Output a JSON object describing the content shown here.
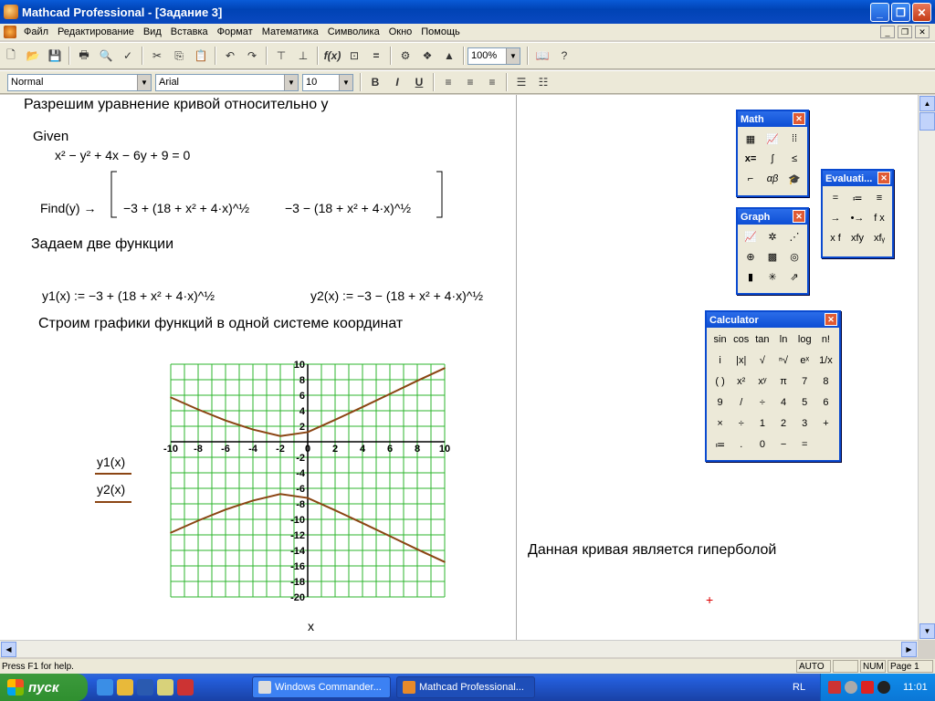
{
  "window": {
    "title": "Mathcad Professional - [Задание 3]"
  },
  "menu": [
    "Файл",
    "Редактирование",
    "Вид",
    "Вставка",
    "Формат",
    "Математика",
    "Символика",
    "Окно",
    "Помощь"
  ],
  "toolbar": {
    "zoom": "100%"
  },
  "format_bar": {
    "style": "Normal",
    "font": "Arial",
    "size": "10",
    "bold": "B",
    "italic": "I",
    "underline": "U"
  },
  "doc": {
    "heading1": "Разрешим уравнение кривой относительно y",
    "given": "Given",
    "equation": "x² − y² + 4x − 6y + 9 = 0",
    "find_label": "Find(y) →",
    "find_r1": "−3 + (18 + x² + 4·x)^½",
    "find_r2": "−3 − (18 + x² + 4·x)^½",
    "heading2": "Задаем две функции",
    "y1_def": "y1(x) := −3 + (18 + x² + 4·x)^½",
    "y2_def": "y2(x) := −3 − (18 + x² + 4·x)^½",
    "heading3": "Строим графики функций в одной системе координат",
    "legend_y1": "y1(x)",
    "legend_y2": "y2(x)",
    "xlabel": "x",
    "conclusion": "Данная кривая является гиперболой",
    "cursor": "+"
  },
  "chart_data": {
    "type": "line",
    "xlim": [
      -10,
      10
    ],
    "ylim": [
      -20,
      10
    ],
    "xticks": [
      -10,
      -8,
      -6,
      -4,
      -2,
      0,
      2,
      4,
      6,
      8,
      10
    ],
    "yticks": [
      10,
      8,
      6,
      4,
      2,
      -2,
      -4,
      -6,
      -8,
      -10,
      -12,
      -14,
      -16,
      -18,
      -20
    ],
    "grid": true,
    "series": [
      {
        "name": "y1(x)",
        "color": "#8b4513",
        "x": [
          -10,
          -8,
          -6,
          -4,
          -2,
          0,
          2,
          4,
          6,
          8,
          10
        ],
        "y": [
          5.72,
          4.16,
          2.74,
          1.58,
          0.74,
          1.24,
          2.83,
          4.48,
          6.16,
          7.86,
          9.49
        ]
      },
      {
        "name": "y2(x)",
        "color": "#8b4513",
        "x": [
          -10,
          -8,
          -6,
          -4,
          -2,
          0,
          2,
          4,
          6,
          8,
          10
        ],
        "y": [
          -11.72,
          -10.16,
          -8.74,
          -7.58,
          -6.74,
          -7.24,
          -8.83,
          -10.48,
          -12.16,
          -13.86,
          -15.49
        ]
      }
    ]
  },
  "palettes": {
    "math": {
      "title": "Math"
    },
    "evaluation": {
      "title": "Evaluati...",
      "cells": [
        "=",
        "≔",
        "≡",
        "→",
        "•→",
        "f x",
        "x f",
        "xfy",
        "xfᵧ"
      ]
    },
    "graph": {
      "title": "Graph"
    },
    "calculator": {
      "title": "Calculator",
      "cells": [
        "sin",
        "cos",
        "tan",
        "ln",
        "log",
        "n!",
        "i",
        "|x|",
        "√",
        "ⁿ√",
        "eˣ",
        "1/x",
        "( )",
        "x²",
        "xʸ",
        "π",
        "7",
        "8",
        "9",
        "/",
        "÷",
        "4",
        "5",
        "6",
        "×",
        "÷",
        "1",
        "2",
        "3",
        "+",
        "≔",
        ".",
        "0",
        "−",
        "="
      ]
    }
  },
  "status": {
    "help": "Press F1 for help.",
    "auto": "AUTO",
    "num": "NUM",
    "page": "Page 1"
  },
  "taskbar": {
    "start": "пуск",
    "task1": "Windows Commander...",
    "task2": "Mathcad Professional...",
    "lang": "RL",
    "time": "11:01"
  }
}
